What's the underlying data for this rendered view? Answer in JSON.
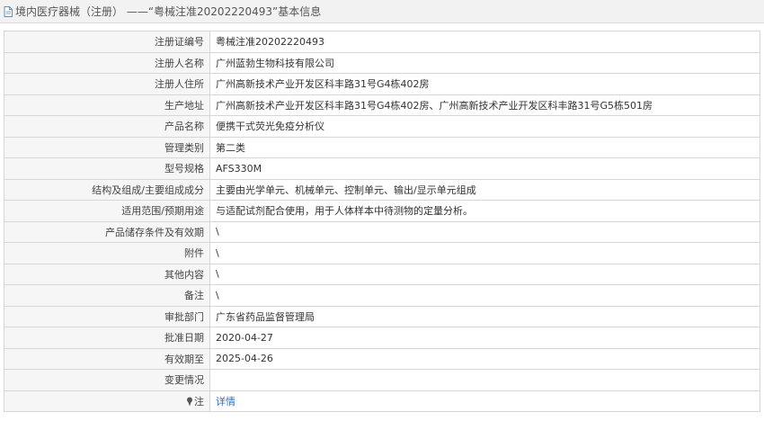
{
  "header": {
    "title": "境内医疗器械（注册） ——“粤械注准20202220493”基本信息"
  },
  "rows": [
    {
      "label": "注册证编号",
      "value": "粤械注准20202220493"
    },
    {
      "label": "注册人名称",
      "value": "广州蓝勃生物科技有限公司"
    },
    {
      "label": "注册人住所",
      "value": "广州高新技术产业开发区科丰路31号G4栋402房"
    },
    {
      "label": "生产地址",
      "value": "广州高新技术产业开发区科丰路31号G4栋402房、广州高新技术产业开发区科丰路31号G5栋501房"
    },
    {
      "label": "产品名称",
      "value": "便携干式荧光免疫分析仪"
    },
    {
      "label": "管理类别",
      "value": "第二类"
    },
    {
      "label": "型号规格",
      "value": "AFS330M"
    },
    {
      "label": "结构及组成/主要组成成分",
      "value": "主要由光学单元、机械单元、控制单元、输出/显示单元组成"
    },
    {
      "label": "适用范围/预期用途",
      "value": "与适配试剂配合使用，用于人体样本中待测物的定量分析。"
    },
    {
      "label": "产品储存条件及有效期",
      "value": "\\"
    },
    {
      "label": "附件",
      "value": "\\"
    },
    {
      "label": "其他内容",
      "value": "\\"
    },
    {
      "label": "备注",
      "value": "\\"
    },
    {
      "label": "审批部门",
      "value": "广东省药品监督管理局"
    },
    {
      "label": "批准日期",
      "value": "2020-04-27"
    },
    {
      "label": "有效期至",
      "value": "2025-04-26"
    },
    {
      "label": "变更情况",
      "value": ""
    }
  ],
  "note_row": {
    "label": "注",
    "link": "详情"
  },
  "icons": {
    "title_icon": "document-icon",
    "note_icon": "pin-icon"
  }
}
